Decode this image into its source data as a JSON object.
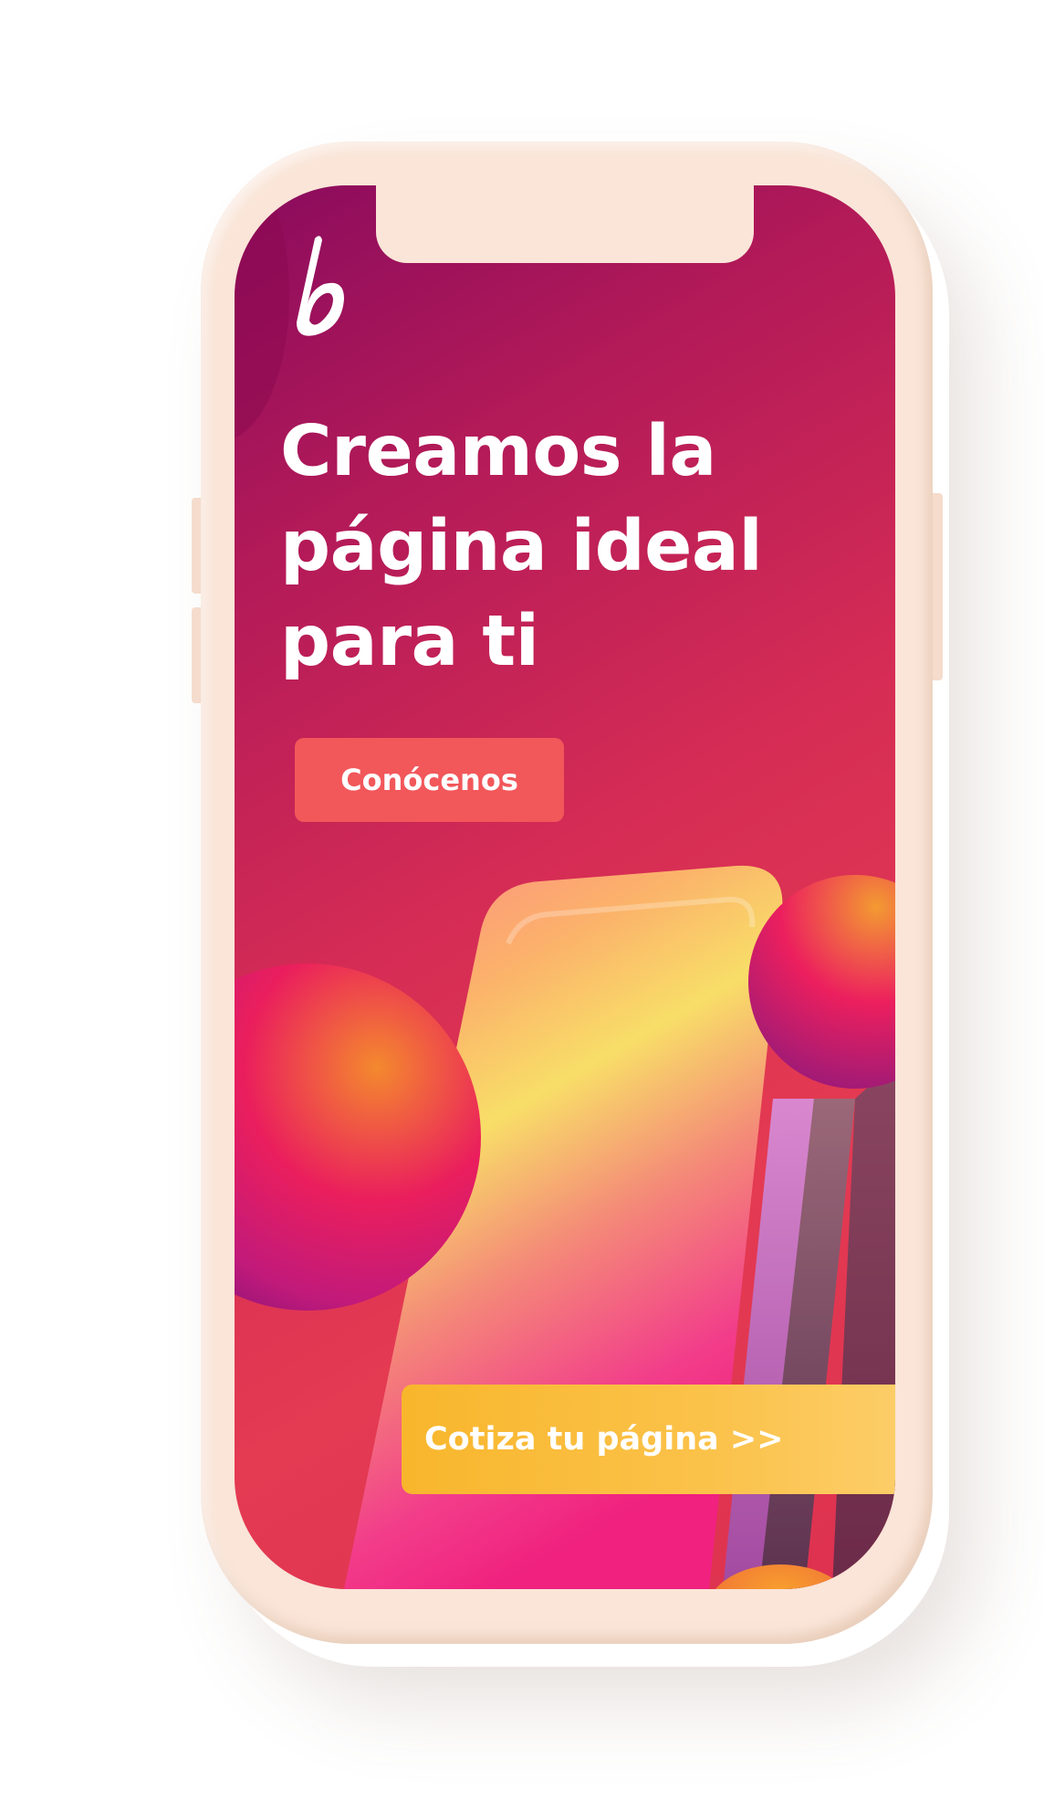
{
  "hero": {
    "headline_lines": [
      "Creamos la",
      "página ideal",
      "para ti"
    ],
    "primary_cta_label": "Conócenos",
    "secondary_cta_label": "Cotiza tu página >>"
  },
  "brand": {
    "logo_icon": "b-logo-icon",
    "colors": {
      "background_start": "#8a0b5e",
      "background_end": "#e43a52",
      "primary_cta": "#f2575a",
      "secondary_cta": "#f8b62c",
      "phone_frame": "#fae5d8",
      "text": "#ffffff"
    }
  }
}
